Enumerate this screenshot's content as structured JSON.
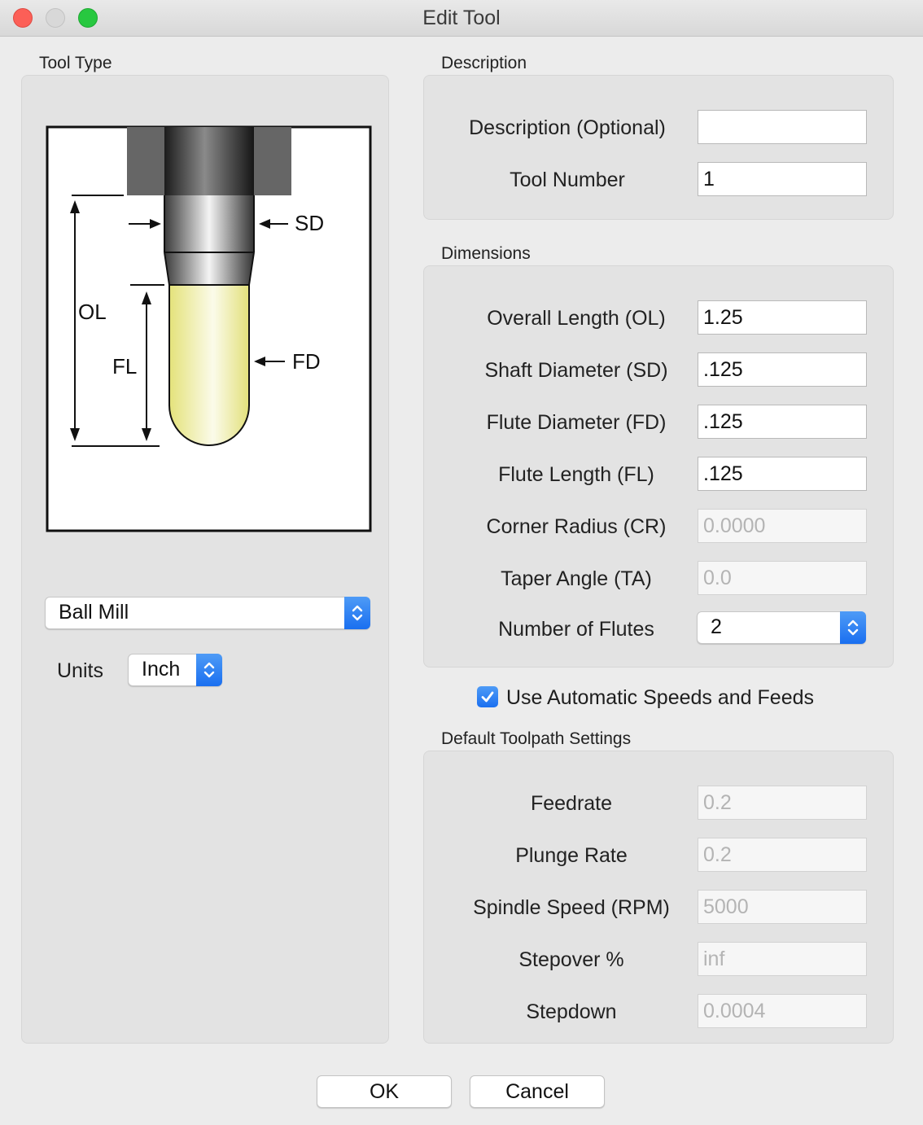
{
  "window": {
    "title": "Edit Tool"
  },
  "tool_type": {
    "section_label": "Tool Type",
    "diagram_labels": {
      "sd": "SD",
      "ol": "OL",
      "fl": "FL",
      "fd": "FD"
    },
    "tool_select": "Ball Mill",
    "units_label": "Units",
    "units_select": "Inch"
  },
  "description": {
    "section_label": "Description",
    "rows": [
      {
        "label": "Description (Optional)",
        "value": ""
      },
      {
        "label": "Tool Number",
        "value": "1"
      }
    ]
  },
  "dimensions": {
    "section_label": "Dimensions",
    "rows": [
      {
        "label": "Overall Length (OL)",
        "value": "1.25"
      },
      {
        "label": "Shaft Diameter (SD)",
        "value": ".125"
      },
      {
        "label": "Flute Diameter (FD)",
        "value": ".125"
      },
      {
        "label": "Flute Length (FL)",
        "value": ".125"
      },
      {
        "label": "Corner Radius (CR)",
        "value": "0.0000"
      },
      {
        "label": "Taper Angle (TA)",
        "value": "0.0"
      }
    ],
    "flutes_label": "Number of Flutes",
    "flutes_value": "2"
  },
  "auto_speeds": {
    "label": "Use Automatic Speeds and Feeds",
    "checked": true
  },
  "toolpath": {
    "section_label": "Default Toolpath Settings",
    "rows": [
      {
        "label": "Feedrate",
        "value": "0.2"
      },
      {
        "label": "Plunge Rate",
        "value": "0.2"
      },
      {
        "label": "Spindle Speed (RPM)",
        "value": "5000"
      },
      {
        "label": "Stepover %",
        "value": "inf"
      },
      {
        "label": "Stepdown",
        "value": "0.0004"
      }
    ]
  },
  "buttons": {
    "ok": "OK",
    "cancel": "Cancel"
  },
  "colors": {
    "accent": "#1a6ff0",
    "close": "#fc5f57",
    "maximize": "#28c840",
    "flute": "#f4f2a8"
  }
}
